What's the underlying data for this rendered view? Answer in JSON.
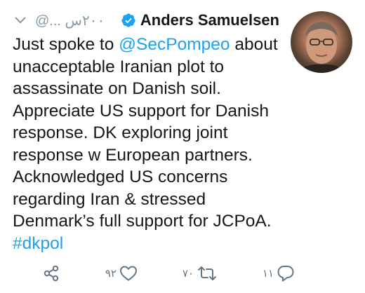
{
  "tweet": {
    "author": {
      "display_name": "Anders Samuelsen",
      "verified": true
    },
    "handle_time": "@... ٢٠٠س",
    "text_lines": [
      {
        "parts": [
          {
            "t": "Just spoke to ",
            "kind": "text"
          },
          {
            "t": "@SecPompeo",
            "kind": "mention"
          },
          {
            "t": " about",
            "kind": "text"
          }
        ]
      },
      {
        "parts": [
          {
            "t": "unacceptable Iranian plot to",
            "kind": "text"
          }
        ]
      },
      {
        "parts": [
          {
            "t": "assassinate on Danish soil.",
            "kind": "text"
          }
        ]
      },
      {
        "parts": [
          {
            "t": "Appreciate US support for Danish",
            "kind": "text"
          }
        ]
      },
      {
        "parts": [
          {
            "t": "response. DK exploring joint",
            "kind": "text"
          }
        ]
      },
      {
        "parts": [
          {
            "t": "response w European partners.",
            "kind": "text"
          }
        ]
      },
      {
        "parts": [
          {
            "t": "Acknowledged US concerns",
            "kind": "text"
          }
        ]
      },
      {
        "parts": [
          {
            "t": "regarding Iran & stressed",
            "kind": "text"
          }
        ]
      },
      {
        "parts": [
          {
            "t": "Denmark’s full support for JCPoA.",
            "kind": "text"
          }
        ]
      },
      {
        "parts": [
          {
            "t": "#dkpol",
            "kind": "hashtag"
          }
        ]
      }
    ],
    "actions": {
      "replies": "١١",
      "retweets": "٧٠",
      "likes": "٩٢"
    }
  },
  "colors": {
    "link": "#1da1f2",
    "muted": "#8899a6",
    "action": "#657786",
    "text": "#14171a"
  },
  "icons": {
    "menu": "chevron-down-icon",
    "verified": "verified-badge-icon",
    "share": "share-icon",
    "like": "heart-icon",
    "retweet": "retweet-icon",
    "reply": "reply-icon"
  }
}
